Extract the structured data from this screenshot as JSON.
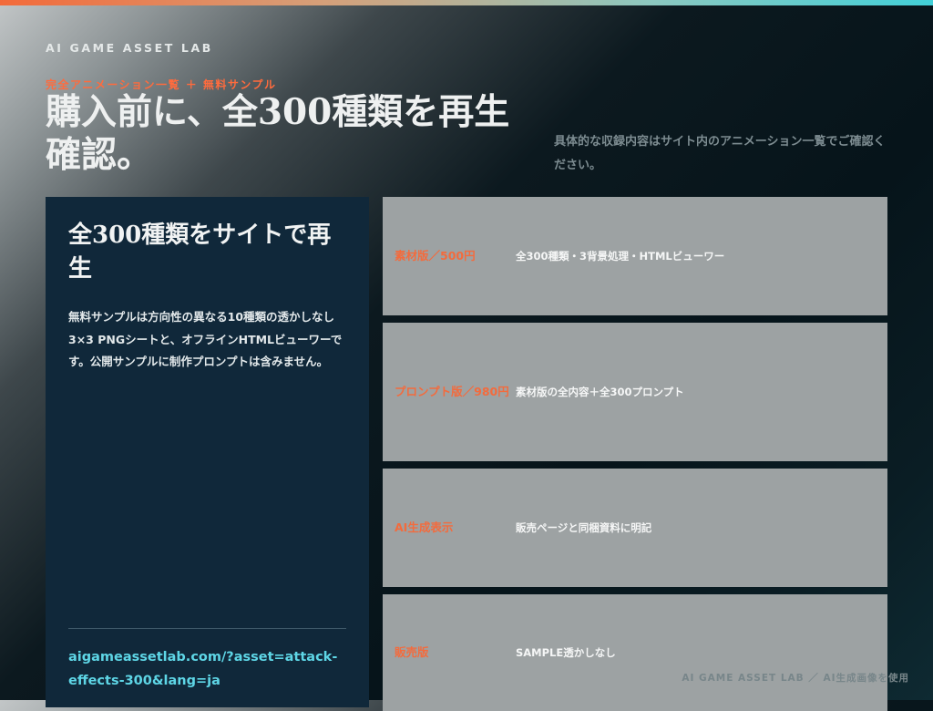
{
  "brand": "AI GAME ASSET LAB",
  "hero": {
    "eyebrow": "完全アニメーション一覧 ＋ 無料サンプル",
    "headline": "購入前に、全300種類を再生確認。",
    "intro": "具体的な収録内容はサイト内のアニメーション一覧でご確認ください。"
  },
  "panel": {
    "title": "全300種類をサイトで再生",
    "body": "無料サンプルは方向性の異なる10種類の透かしなし3×3 PNGシートと、オフラインHTMLビューワーです。公開サンプルに制作プロンプトは含みません。",
    "link": "aigameassetlab.com/?asset=attack-effects-300&lang=ja"
  },
  "features": [
    {
      "label": "素材版／500円",
      "value": "全300種類・3背景処理・HTMLビューワー"
    },
    {
      "label": "プロンプト版／980円",
      "value": "素材版の全内容＋全300プロンプト"
    },
    {
      "label": "AI生成表示",
      "value": "販売ページと同梱資料に明記"
    },
    {
      "label": "販売版",
      "value": "SAMPLE透かしなし"
    }
  ],
  "footer": "AI GAME ASSET LAB ／ AI生成画像を使用",
  "colors": {
    "accent_orange": "#ff6b3d",
    "link_cyan": "#5ed6e6",
    "panel_navy": "#10283a",
    "card_gray": "#9da2a3"
  }
}
